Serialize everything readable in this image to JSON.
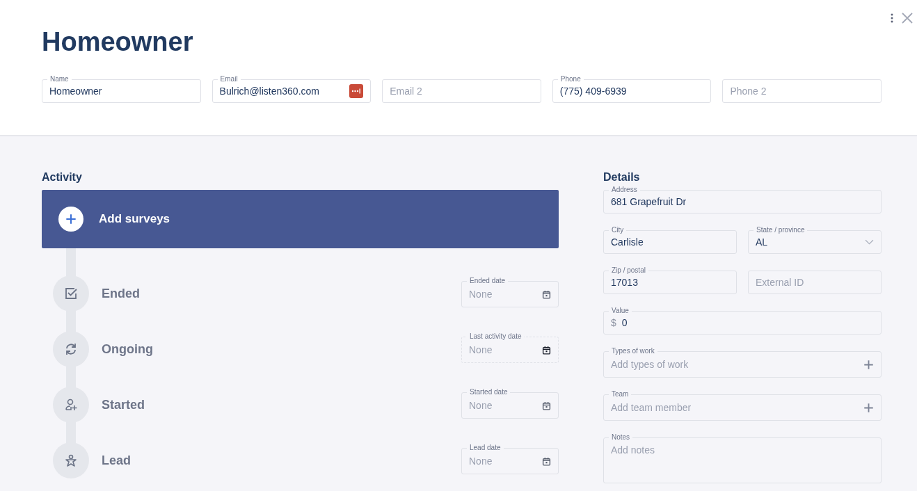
{
  "header": {
    "title": "Homeowner",
    "fields": [
      {
        "label": "Name",
        "value": "Homeowner"
      },
      {
        "label": "Email",
        "value": "Bulrich@listen360.com",
        "password_manager": true
      },
      {
        "placeholder": "Email 2"
      },
      {
        "label": "Phone",
        "value": "(775) 409-6939"
      },
      {
        "placeholder": "Phone 2"
      }
    ]
  },
  "activity": {
    "title": "Activity",
    "add_button": "Add surveys",
    "stages": [
      {
        "kind": "ended",
        "label": "Ended",
        "date": {
          "label": "Ended date",
          "placeholder": "None",
          "readonly": false
        }
      },
      {
        "kind": "ongoing",
        "label": "Ongoing",
        "date": {
          "label": "Last activity date",
          "placeholder": "None",
          "readonly": true
        }
      },
      {
        "kind": "started",
        "label": "Started",
        "date": {
          "label": "Started date",
          "placeholder": "None",
          "readonly": false
        }
      },
      {
        "kind": "lead",
        "label": "Lead",
        "date": {
          "label": "Lead date",
          "placeholder": "None",
          "readonly": false
        }
      }
    ]
  },
  "details": {
    "title": "Details",
    "rows": [
      [
        {
          "kind": "text",
          "label": "Address",
          "value": "681 Grapefruit Dr"
        }
      ],
      [
        {
          "kind": "text",
          "label": "City",
          "value": "Carlisle"
        },
        {
          "kind": "select",
          "label": "State / province",
          "value": "AL"
        }
      ],
      [
        {
          "kind": "text",
          "label": "Zip / postal",
          "value": "17013"
        },
        {
          "kind": "text",
          "placeholder": "External ID"
        }
      ],
      [
        {
          "kind": "currency",
          "label": "Value",
          "prefix": "$",
          "value": "0"
        }
      ],
      [
        {
          "kind": "add",
          "label": "Types of work",
          "placeholder": "Add types of work"
        }
      ],
      [
        {
          "kind": "add",
          "label": "Team",
          "placeholder": "Add team member"
        }
      ],
      [
        {
          "kind": "textarea",
          "label": "Notes",
          "placeholder": "Add notes"
        }
      ]
    ]
  }
}
